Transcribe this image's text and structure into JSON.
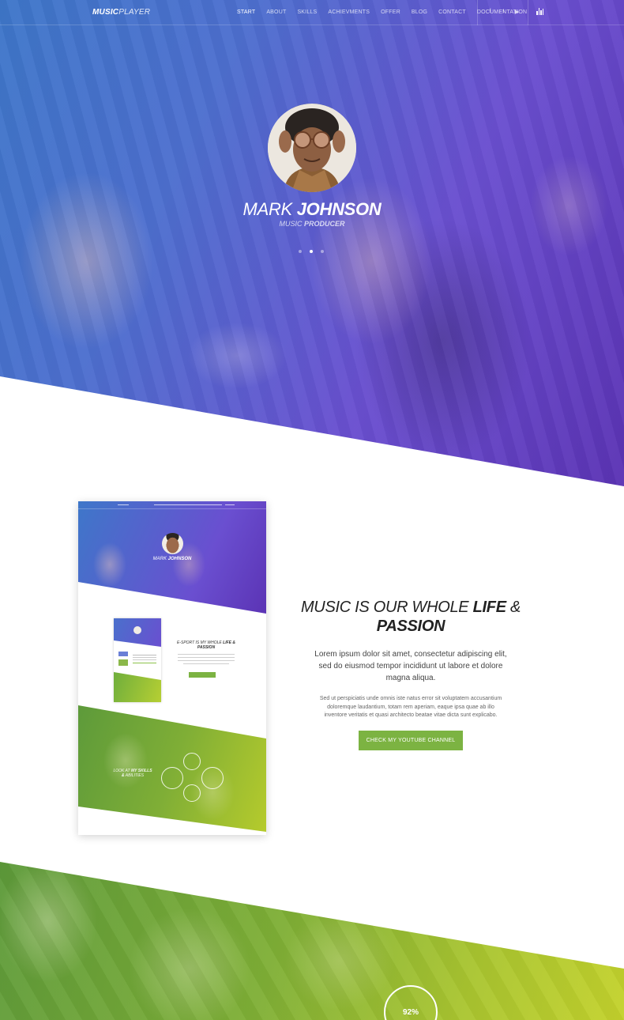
{
  "nav": {
    "logo_bold": "MUSIC",
    "logo_thin": "PLAYER",
    "items": [
      "START",
      "ABOUT",
      "SKILLS",
      "ACHIEVMENTS",
      "OFFER",
      "BLOG",
      "CONTACT",
      "DOCUMENTATION"
    ],
    "active": "START",
    "social": [
      {
        "name": "facebook-icon",
        "glyph": "f"
      },
      {
        "name": "twitter-icon",
        "glyph": "t"
      },
      {
        "name": "youtube-icon",
        "glyph": "▶"
      }
    ]
  },
  "hero": {
    "first_name": "MARK",
    "last_name": "JOHNSON",
    "role_light": "MUSIC",
    "role_bold": "PRODUCER",
    "slides": 3,
    "active_slide": 2
  },
  "about": {
    "title_light": "MUSIC IS OUR WHOLE",
    "title_bold_1": "LIFE",
    "title_amp": "&",
    "title_bold_2": "PASSION",
    "lead": "Lorem ipsum dolor sit amet, consectetur adipiscing elit, sed do eiusmod tempor incididunt ut labore et dolore magna aliqua.",
    "body": "Sed ut perspiciatis unde omnis iste natus error sit voluptatem accusantium doloremque laudantium, totam rem aperiam, eaque ipsa quae ab illo inventore veritatis et quasi architecto beatae vitae dicta sunt explicabo.",
    "button": "CHECK MY YOUTUBE CHANNEL"
  },
  "mockup": {
    "name_light": "MARK",
    "name_bold": "JOHNSON",
    "title_light": "E-SPORT IS MY WHOLE",
    "title_bold": "LIFE & PASSION",
    "green_light": "LOOK AT",
    "green_bold": "MY SKILLS &",
    "green_tail": "ABILITIES"
  },
  "skills": {
    "first_value": "92%"
  },
  "colors": {
    "accent": "#7cb342",
    "hero_start": "#3e77c9",
    "hero_end": "#5b33b4",
    "green_start": "#5d9a3a",
    "green_end": "#c4d22c"
  }
}
